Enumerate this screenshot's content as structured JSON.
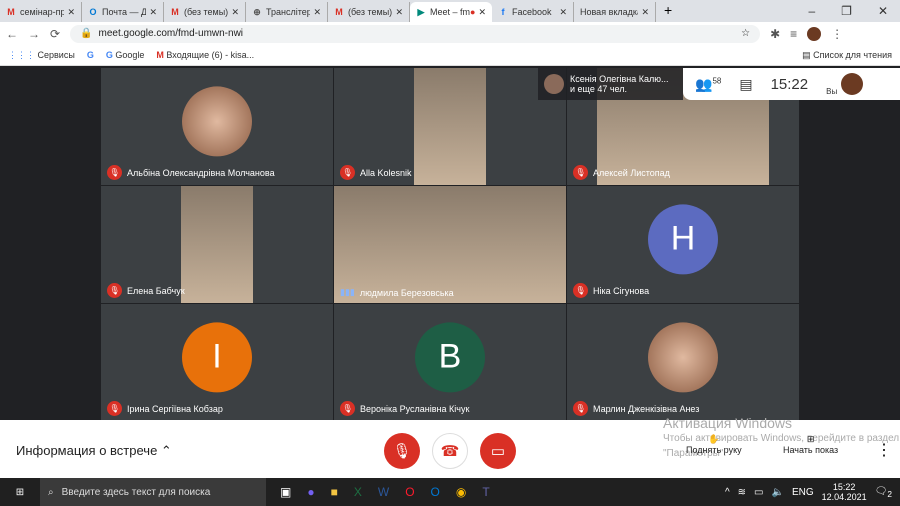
{
  "tabs": [
    {
      "label": "семінар-практ",
      "icon": "gmail-icon"
    },
    {
      "label": "Почта — Діхт",
      "icon": "outlook-icon"
    },
    {
      "label": "(без темы) - d",
      "icon": "gmail-icon"
    },
    {
      "label": "Транслітерації",
      "icon": "globe-icon"
    },
    {
      "label": "(без темы) - d",
      "icon": "gmail-icon"
    },
    {
      "label": "Meet – fmd",
      "icon": "meet-icon",
      "active": true
    },
    {
      "label": "Facebook",
      "icon": "facebook-icon"
    },
    {
      "label": "Новая вкладка",
      "icon": ""
    }
  ],
  "url": "meet.google.com/fmd-umwn-nwi",
  "bookmarks": {
    "apps": "Сервисы",
    "google": "Google",
    "inbox": "Входящие (6) - kisa...",
    "reading_list": "Список для чтения"
  },
  "meet": {
    "info_name": "Ксенія Олегівна Калю...",
    "info_more": "и еще 47 чел.",
    "participants_count": "58",
    "time": "15:22",
    "you": "Вы",
    "tiles": [
      {
        "name": "Альбіна Олександрівна Молчанова",
        "muted": true,
        "type": "avatar-photo"
      },
      {
        "name": "Alla Kolesnik",
        "muted": true,
        "type": "video"
      },
      {
        "name": "Алексей Листопад",
        "muted": true,
        "type": "video"
      },
      {
        "name": "Елена Бабчук",
        "muted": true,
        "type": "video"
      },
      {
        "name": "людмила Березовська",
        "muted": false,
        "type": "video"
      },
      {
        "name": "Ніка Сігунова",
        "muted": true,
        "type": "avatar",
        "letter": "H",
        "color": "#5c6bc0"
      },
      {
        "name": "Ірина Сергіївна Кобзар",
        "muted": true,
        "type": "avatar",
        "letter": "I",
        "color": "#e8710a"
      },
      {
        "name": "Вероніка Русланівна Кічук",
        "muted": true,
        "type": "avatar",
        "letter": "B",
        "color": "#1e5e45"
      },
      {
        "name": "Марлин Дженкізівна Анез",
        "muted": true,
        "type": "avatar-photo"
      }
    ],
    "meeting_info": "Информация о встрече",
    "raise_hand": "Поднять руку",
    "present": "Начать показ",
    "activation_title": "Активация Windows",
    "activation_text": "Чтобы активировать Windows, перейдите в раздел \"Параметры\"."
  },
  "taskbar": {
    "search": "Введите здесь текст для поиска",
    "lang": "ENG",
    "time": "15:22",
    "date": "12.04.2021",
    "notifications": "2"
  }
}
